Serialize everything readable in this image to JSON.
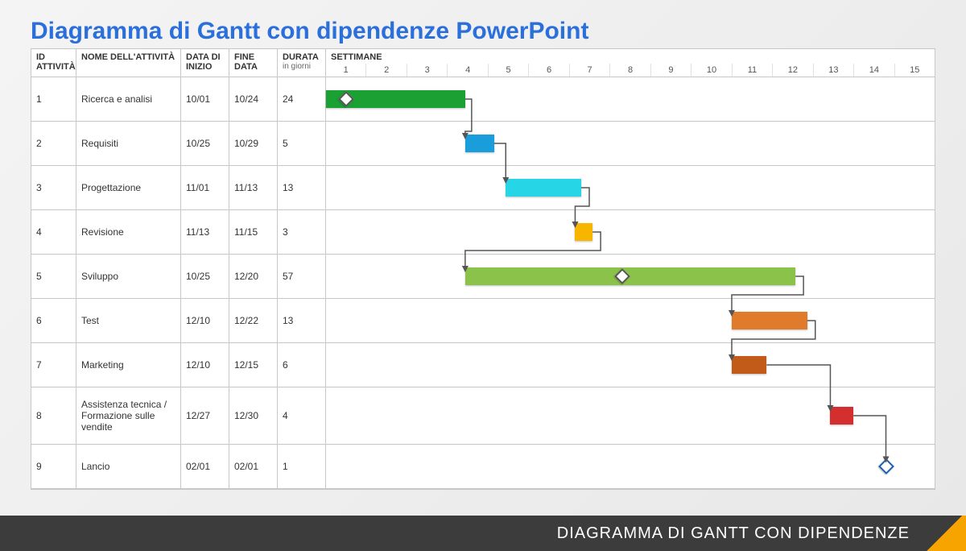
{
  "title": "Diagramma di Gantt con dipendenze PowerPoint",
  "footer_text": "DIAGRAMMA DI GANTT CON DIPENDENZE",
  "headers": {
    "id": "ID ATTIVITÀ",
    "name": "NOME DELL'ATTIVITÀ",
    "start": "DATA DI INIZIO",
    "end": "FINE DATA",
    "duration": "DURATA",
    "duration_sub": "in giorni",
    "weeks": "SETTIMANE"
  },
  "weeks": [
    "1",
    "2",
    "3",
    "4",
    "5",
    "6",
    "7",
    "8",
    "9",
    "10",
    "11",
    "12",
    "13",
    "14",
    "15"
  ],
  "tasks": [
    {
      "id": "1",
      "name": "Ricerca e analisi",
      "start": "10/01",
      "end": "10/24",
      "dur": "24"
    },
    {
      "id": "2",
      "name": "Requisiti",
      "start": "10/25",
      "end": "10/29",
      "dur": "5"
    },
    {
      "id": "3",
      "name": "Progettazione",
      "start": "11/01",
      "end": "11/13",
      "dur": "13"
    },
    {
      "id": "4",
      "name": "Revisione",
      "start": "11/13",
      "end": "11/15",
      "dur": "3"
    },
    {
      "id": "5",
      "name": "Sviluppo",
      "start": "10/25",
      "end": "12/20",
      "dur": "57"
    },
    {
      "id": "6",
      "name": "Test",
      "start": "12/10",
      "end": "12/22",
      "dur": "13"
    },
    {
      "id": "7",
      "name": "Marketing",
      "start": "12/10",
      "end": "12/15",
      "dur": "6"
    },
    {
      "id": "8",
      "name": "Assistenza tecnica / Formazione sulle vendite",
      "start": "12/27",
      "end": "12/30",
      "dur": "4"
    },
    {
      "id": "9",
      "name": "Lancio",
      "start": "02/01",
      "end": "02/01",
      "dur": "1"
    }
  ],
  "chart_data": {
    "type": "gantt",
    "x_unit": "weeks",
    "x_range": [
      0,
      15
    ],
    "bars": [
      {
        "task": "Ricerca e analisi",
        "row": 0,
        "start": 0.0,
        "end": 3.43,
        "color": "#1aa033",
        "milestone_at": 0.5
      },
      {
        "task": "Requisiti",
        "row": 1,
        "start": 3.43,
        "end": 4.14,
        "color": "#1a9edb"
      },
      {
        "task": "Progettazione",
        "row": 2,
        "start": 4.43,
        "end": 6.29,
        "color": "#27d6e6"
      },
      {
        "task": "Revisione",
        "row": 3,
        "start": 6.14,
        "end": 6.57,
        "color": "#f7b500"
      },
      {
        "task": "Sviluppo",
        "row": 4,
        "start": 3.43,
        "end": 11.57,
        "color": "#8bc34a",
        "milestone_at": 7.3
      },
      {
        "task": "Test",
        "row": 5,
        "start": 10.0,
        "end": 11.86,
        "color": "#e07b2c"
      },
      {
        "task": "Marketing",
        "row": 6,
        "start": 10.0,
        "end": 10.86,
        "color": "#c25a1a"
      },
      {
        "task": "Assistenza tecnica / Formazione sulle vendite",
        "row": 7,
        "start": 12.43,
        "end": 13.0,
        "color": "#d32f2f"
      },
      {
        "task": "Lancio",
        "row": 8,
        "start": 13.8,
        "end": 13.8,
        "color": "#1a5fb4",
        "is_milestone": true
      }
    ],
    "dependencies": [
      {
        "from": 0,
        "to": 1
      },
      {
        "from": 1,
        "to": 2
      },
      {
        "from": 2,
        "to": 3
      },
      {
        "from": 3,
        "to": 4
      },
      {
        "from": 4,
        "to": 5
      },
      {
        "from": 5,
        "to": 6
      },
      {
        "from": 6,
        "to": 7
      },
      {
        "from": 7,
        "to": 8
      }
    ]
  }
}
